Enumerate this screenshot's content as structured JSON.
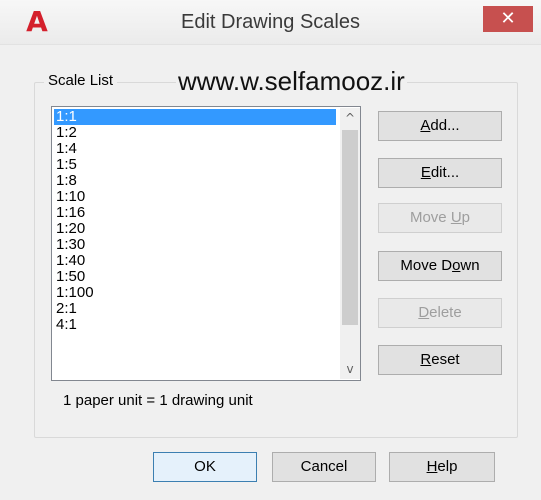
{
  "window": {
    "title": "Edit Drawing Scales",
    "app_logo": "A",
    "close_glyph": "✕"
  },
  "watermark": "www.w.selfamooz.ir",
  "scale_list": {
    "label": "Scale List",
    "items": [
      "1:1",
      "1:2",
      "1:4",
      "1:5",
      "1:8",
      "1:10",
      "1:16",
      "1:20",
      "1:30",
      "1:40",
      "1:50",
      "1:100",
      "2:1",
      "4:1"
    ],
    "selected": "1:1",
    "scroll_up_glyph": "^",
    "scroll_down_glyph": "v"
  },
  "side_buttons": {
    "add": {
      "pre": "",
      "u": "A",
      "post": "dd...",
      "enabled": true
    },
    "edit": {
      "pre": "",
      "u": "E",
      "post": "dit...",
      "enabled": true
    },
    "move_up": {
      "pre": "Move ",
      "u": "U",
      "post": "p",
      "enabled": false
    },
    "move_down": {
      "pre": "Move D",
      "u": "o",
      "post": "wn",
      "enabled": true
    },
    "delete": {
      "pre": "",
      "u": "D",
      "post": "elete",
      "enabled": false
    },
    "reset": {
      "pre": "",
      "u": "R",
      "post": "eset",
      "enabled": true
    }
  },
  "unit_text": "1 paper unit = 1 drawing unit",
  "footer_buttons": {
    "ok": "OK",
    "cancel": "Cancel",
    "help": {
      "pre": "",
      "u": "H",
      "post": "elp"
    }
  },
  "colors": {
    "selection": "#3399ff",
    "close_button": "#c7504f",
    "logo": "#d4202c"
  }
}
